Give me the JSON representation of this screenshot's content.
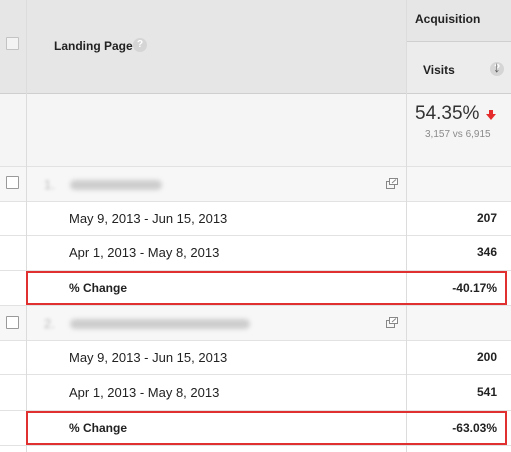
{
  "header": {
    "group_label": "Acquisition",
    "dimension_label": "Landing Page",
    "dimension_help": "?",
    "metric_label": "Visits",
    "metric_help": "?",
    "sort_arrow": "↓"
  },
  "summary": {
    "percent": "54.35%",
    "comparison": "3,157 vs 6,915",
    "trend": "down",
    "trend_color": "#e52b2b"
  },
  "groups": [
    {
      "index": "1.",
      "page_label_blurred": true,
      "rows": [
        {
          "label": "May 9, 2013 - Jun 15, 2013",
          "value": "207"
        },
        {
          "label": "Apr 1, 2013 - May 8, 2013",
          "value": "346"
        }
      ],
      "change": {
        "label": "% Change",
        "value": "-40.17%"
      }
    },
    {
      "index": "2.",
      "page_label_blurred": true,
      "rows": [
        {
          "label": "May 9, 2013 - Jun 15, 2013",
          "value": "200"
        },
        {
          "label": "Apr 1, 2013 - May 8, 2013",
          "value": "541"
        }
      ],
      "change": {
        "label": "% Change",
        "value": "-63.03%"
      }
    }
  ],
  "colors": {
    "highlight": "#e03030",
    "header_bg": "#e6e6e6"
  }
}
